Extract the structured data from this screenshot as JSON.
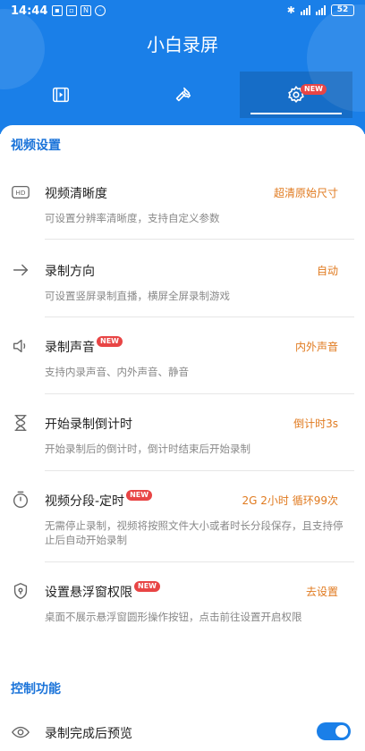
{
  "status_bar": {
    "time": "14:44",
    "battery": "52"
  },
  "app": {
    "title": "小白录屏"
  },
  "tabs": [
    {
      "name": "video-tab",
      "icon": "film-icon"
    },
    {
      "name": "tools-tab",
      "icon": "wrench-icon"
    },
    {
      "name": "settings-tab",
      "icon": "gear-icon",
      "badge": "NEW",
      "active": true
    }
  ],
  "sections": {
    "video": "视频设置",
    "control": "控制功能"
  },
  "settings": [
    {
      "icon": "hd-icon",
      "title": "视频清晰度",
      "value": "超清原始尺寸",
      "desc": "可设置分辨率清晰度，支持自定义参数"
    },
    {
      "icon": "arrow-right-icon",
      "title": "录制方向",
      "value": "自动",
      "desc": "可设置竖屏录制直播，横屏全屏录制游戏"
    },
    {
      "icon": "speaker-icon",
      "title": "录制声音",
      "badge": "NEW",
      "value": "内外声音",
      "desc": "支持内录声音、内外声音、静音"
    },
    {
      "icon": "hourglass-icon",
      "title": "开始录制倒计时",
      "value": "倒计时3s",
      "desc": "开始录制后的倒计时，倒计时结束后开始录制"
    },
    {
      "icon": "timer-icon",
      "title": "视频分段-定时",
      "badge": "NEW",
      "value": "2G 2小时 循环99次",
      "desc": "无需停止录制，视频将按照文件大小或者时长分段保存，且支持停止后自动开始录制"
    },
    {
      "icon": "shield-icon",
      "title": "设置悬浮窗权限",
      "badge": "NEW",
      "value": "去设置",
      "desc": "桌面不展示悬浮窗圆形操作按钮，点击前往设置开启权限"
    }
  ],
  "controls": [
    {
      "icon": "eye-icon",
      "title": "录制完成后预览",
      "enabled": true
    }
  ],
  "colors": {
    "brand": "#1a7fe8",
    "section": "#1a73d9",
    "value": "#e07a1f",
    "badge": "#e84545"
  }
}
